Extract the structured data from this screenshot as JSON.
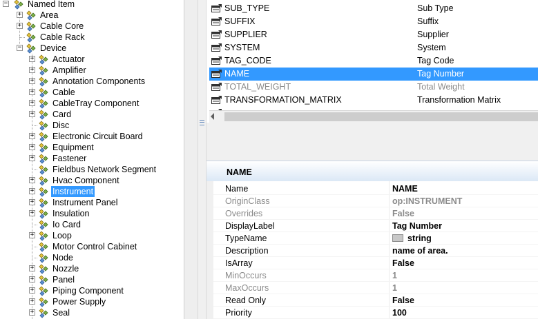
{
  "tree": {
    "root": {
      "label": "Named Item",
      "expanded": true
    },
    "items": [
      {
        "label": "Area",
        "level": 1,
        "expander": "+"
      },
      {
        "label": "Cable Core",
        "level": 1,
        "expander": "+"
      },
      {
        "label": "Cable Rack",
        "level": 1,
        "expander": ""
      },
      {
        "label": "Device",
        "level": 1,
        "expander": "-"
      },
      {
        "label": "Actuator",
        "level": 2,
        "expander": "+"
      },
      {
        "label": "Amplifier",
        "level": 2,
        "expander": "+"
      },
      {
        "label": "Annotation Components",
        "level": 2,
        "expander": "+"
      },
      {
        "label": "Cable",
        "level": 2,
        "expander": "+"
      },
      {
        "label": "CableTray Component",
        "level": 2,
        "expander": "+"
      },
      {
        "label": "Card",
        "level": 2,
        "expander": "+"
      },
      {
        "label": "Disc",
        "level": 2,
        "expander": ""
      },
      {
        "label": "Electronic Circuit Board",
        "level": 2,
        "expander": "+"
      },
      {
        "label": "Equipment",
        "level": 2,
        "expander": "+"
      },
      {
        "label": "Fastener",
        "level": 2,
        "expander": "+"
      },
      {
        "label": "Fieldbus Network Segment",
        "level": 2,
        "expander": ""
      },
      {
        "label": "Hvac Component",
        "level": 2,
        "expander": "+"
      },
      {
        "label": "Instrument",
        "level": 2,
        "expander": "+",
        "selected": true
      },
      {
        "label": "Instrument Panel",
        "level": 2,
        "expander": "+"
      },
      {
        "label": "Insulation",
        "level": 2,
        "expander": "+"
      },
      {
        "label": "Io Card",
        "level": 2,
        "expander": ""
      },
      {
        "label": "Loop",
        "level": 2,
        "expander": "+"
      },
      {
        "label": "Motor Control Cabinet",
        "level": 2,
        "expander": ""
      },
      {
        "label": "Node",
        "level": 2,
        "expander": ""
      },
      {
        "label": "Nozzle",
        "level": 2,
        "expander": "+"
      },
      {
        "label": "Panel",
        "level": 2,
        "expander": "+"
      },
      {
        "label": "Piping Component",
        "level": 2,
        "expander": "+"
      },
      {
        "label": "Power Supply",
        "level": 2,
        "expander": "+"
      },
      {
        "label": "Seal",
        "level": 2,
        "expander": "+"
      }
    ]
  },
  "attributes": {
    "rows": [
      {
        "name": "SUB_TYPE",
        "description": "Sub Type"
      },
      {
        "name": "SUFFIX",
        "description": "Suffix"
      },
      {
        "name": "SUPPLIER",
        "description": "Supplier"
      },
      {
        "name": "SYSTEM",
        "description": "System"
      },
      {
        "name": "TAG_CODE",
        "description": "Tag Code"
      },
      {
        "name": "NAME",
        "description": "Tag Number",
        "selected": true
      },
      {
        "name": "TOTAL_WEIGHT",
        "description": "Total Weight",
        "disabled": true
      },
      {
        "name": "TRANSFORMATION_MATRIX",
        "description": "Transformation Matrix"
      }
    ]
  },
  "properties": {
    "title": "NAME",
    "rows": [
      {
        "name": "Name",
        "value": "NAME"
      },
      {
        "name": "OriginClass",
        "value": "op:INSTRUMENT",
        "readonly": true
      },
      {
        "name": "Overrides",
        "value": "False",
        "readonly": true
      },
      {
        "name": "DisplayLabel",
        "value": "Tag Number"
      },
      {
        "name": "TypeName",
        "value": "string",
        "icon": "type-icon"
      },
      {
        "name": "Description",
        "value": "name of area."
      },
      {
        "name": "IsArray",
        "value": "False"
      },
      {
        "name": "MinOccurs",
        "value": "1",
        "readonly": true
      },
      {
        "name": "MaxOccurs",
        "value": "1",
        "readonly": true
      },
      {
        "name": "Read Only",
        "value": "False"
      },
      {
        "name": "Priority",
        "value": "100"
      }
    ]
  },
  "colors": {
    "selection": "#3399ff",
    "header_gradient_end": "#dbe8f6",
    "disabled_text": "#8a8a8a"
  }
}
